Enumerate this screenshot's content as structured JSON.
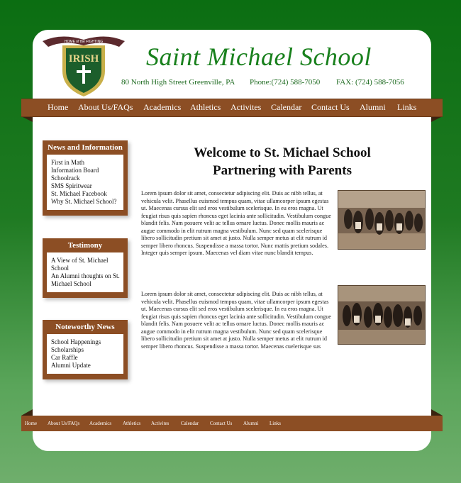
{
  "header": {
    "title": "Saint Michael School",
    "address": "80 North High Street Greenville, PA",
    "phone": "Phone:(724) 588-7050",
    "fax": "FAX: (724) 588-7056",
    "logo": {
      "banner_text": "HOME of the FIGHTING",
      "name": "IRISH",
      "colors": {
        "green": "#1c5e2b",
        "gold": "#c9b04a",
        "maroon": "#5c2a2e"
      }
    }
  },
  "nav": {
    "items": [
      "Home",
      "About Us/FAQs",
      "Academics",
      "Athletics",
      "Activites",
      "Calendar",
      "Contact Us",
      "Alumni",
      "Links"
    ]
  },
  "sidebar": {
    "news": {
      "title": "News and Information",
      "items": [
        "First in Math",
        "Information Board",
        "Schoolrack",
        "SMS Spiritwear",
        "St. Michael Facebook",
        "Why St. Michael School?"
      ]
    },
    "testimony": {
      "title": "Testimony",
      "items": [
        "A View of St. Michael School",
        "An Alumni thoughts on St. Michael School"
      ]
    },
    "noteworthy": {
      "title": "Noteworthy News",
      "items": [
        "School Happenings",
        "Scholarships",
        "Car Raffle",
        "Alumni Update"
      ]
    }
  },
  "main": {
    "heading1": "Welcome to St. Michael School",
    "heading2": "Partnering with Parents",
    "paragraph1": "Lorem ipsum dolor sit amet, consectetur adipiscing elit. Duis ac nibh tellus, at vehicula velit. Phasellus euismod tempus quam, vitae ullamcorper ipsum egestas ut. Maecenas cursus elit sed eros vestibulum scelerisque. In eu eros magna. Ut feugiat risus quis sapien rhoncus eget lacinia ante sollicitudin. Vestibulum congue blandit felis. Nam posuere velit ac tellus ornare luctus. Donec mollis mauris ac augue commodo in elit rutrum magna vestibulum. Nunc sed quam scelerisque libero sollicitudin pretium sit amet at justo. Nulla semper metus at elit rutrum id semper libero rhoncus. Suspendisse a massa tortor. Nunc mattis pretium sodales. Integer quis semper ipsum. Maecenas vel diam vitae nunc blandit tempus.",
    "paragraph2": "Lorem ipsum dolor sit amet, consectetur adipiscing elit. Duis ac nibh tellus, at vehicula velit. Phasellus euismod tempus quam, vitae ullamcorper ipsum egestas ut. Maecenas cursus elit sed eros vestibulum scelerisque. In eu eros magna. Ut feugiat risus quis sapien rhoncus eget lacinia ante sollicitudin. Vestibulum congue blandit felis. Nam posuere velit ac tellus ornare luctus. Donec mollis mauris ac augue commodo in elit rutrum magna vestibulum. Nunc sed quam scelerisque libero sollicitudin pretium sit amet at justo. Nulla semper metus at elit rutrum id semper libero rhoncus. Suspendisse a massa tortor. Maecenas cuelerisque sus"
  },
  "footer": {
    "items": [
      "Home",
      "About Us/FAQs",
      "Academics",
      "Athletics",
      "Activites",
      "Calendar",
      "Contact Us",
      "Alumni",
      "Links"
    ]
  },
  "colors": {
    "brand_green": "#18801c",
    "nav_brown": "#8c4e24"
  }
}
